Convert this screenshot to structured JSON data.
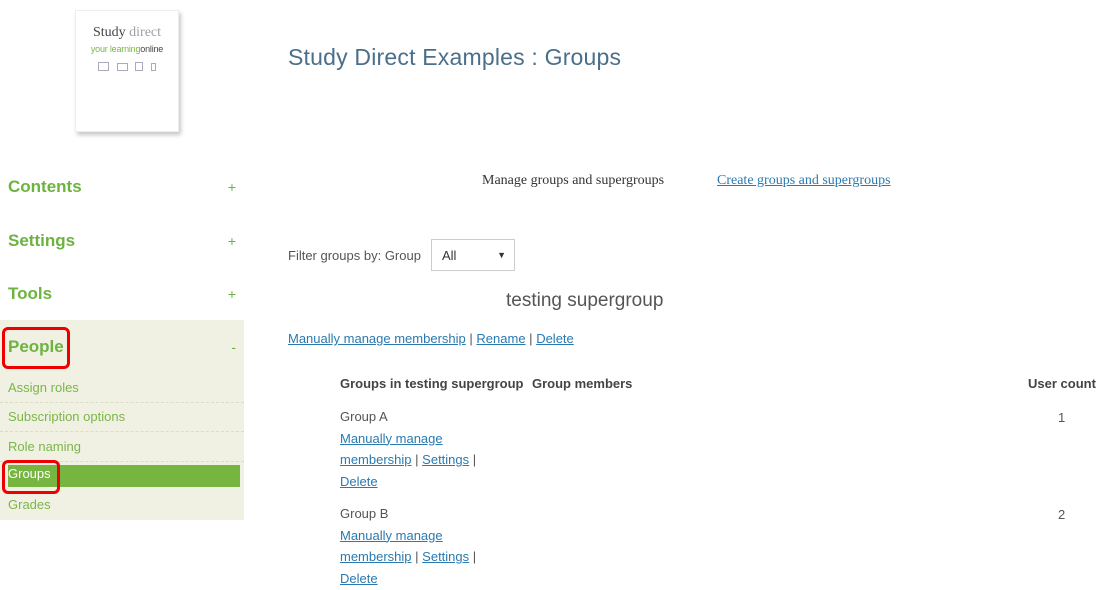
{
  "logo": {
    "word1": "Study",
    "word2": "direct",
    "tag_part1": "your learning",
    "tag_part2": "online"
  },
  "page_title": "Study Direct Examples : Groups",
  "sidebar": {
    "sections": [
      {
        "label": "Contents",
        "toggle": "+"
      },
      {
        "label": "Settings",
        "toggle": "+"
      },
      {
        "label": "Tools",
        "toggle": "+"
      },
      {
        "label": "People",
        "toggle": "-"
      }
    ],
    "people_items": [
      "Assign roles",
      "Subscription options",
      "Role naming",
      "Groups",
      "Grades"
    ],
    "active_item": "Groups"
  },
  "tabs": {
    "manage": "Manage groups and supergroups",
    "create": "Create groups and supergroups"
  },
  "filter": {
    "label": "Filter groups by: Group",
    "selected": "All"
  },
  "supergroup": {
    "title": "testing supergroup",
    "actions": {
      "manage": "Manually manage membership",
      "rename": "Rename",
      "delete": "Delete",
      "sep": "|"
    }
  },
  "table": {
    "headers": {
      "groups": "Groups in testing supergroup",
      "members": "Group members",
      "count": "User count"
    },
    "rows": [
      {
        "name": "Group A",
        "manage1": "Manually manage",
        "manage2": "membership",
        "settings": "Settings",
        "delete": "Delete",
        "count": "1"
      },
      {
        "name": "Group B",
        "manage1": "Manually manage",
        "manage2": "membership",
        "settings": "Settings",
        "delete": "Delete",
        "count": "2"
      }
    ]
  },
  "colors": {
    "accent_green": "#6db33f",
    "active_bg": "#76b53f",
    "link_blue": "#2a7ab0",
    "title_blue": "#4a6f8a",
    "highlight_red": "#e00000",
    "people_bg": "#f1f1e3"
  }
}
